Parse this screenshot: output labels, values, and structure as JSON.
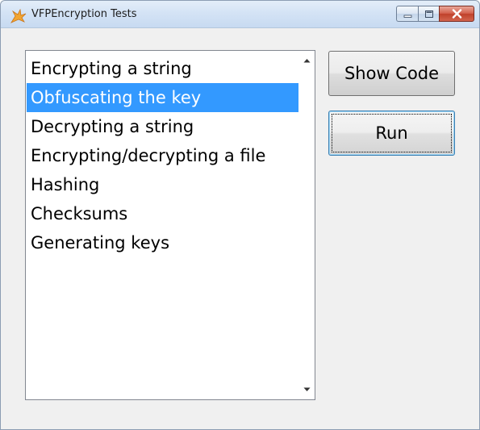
{
  "window": {
    "title": "VFPEncryption Tests",
    "icon": "fox-logo-icon"
  },
  "caption_buttons": {
    "minimize_icon": "minimize-icon",
    "maximize_icon": "maximize-icon",
    "close_icon": "close-icon"
  },
  "list": {
    "items": [
      {
        "label": "Encrypting a string",
        "selected": false
      },
      {
        "label": "Obfuscating the key",
        "selected": true
      },
      {
        "label": "Decrypting a string",
        "selected": false
      },
      {
        "label": "Encrypting/decrypting a file",
        "selected": false
      },
      {
        "label": "Hashing",
        "selected": false
      },
      {
        "label": "Checksums",
        "selected": false
      },
      {
        "label": "Generating keys",
        "selected": false
      }
    ]
  },
  "buttons": {
    "show_code": "Show Code",
    "run": "Run"
  },
  "colors": {
    "selection": "#3399ff",
    "selection_text": "#ffffff",
    "window_bg": "#f0f0f0"
  }
}
